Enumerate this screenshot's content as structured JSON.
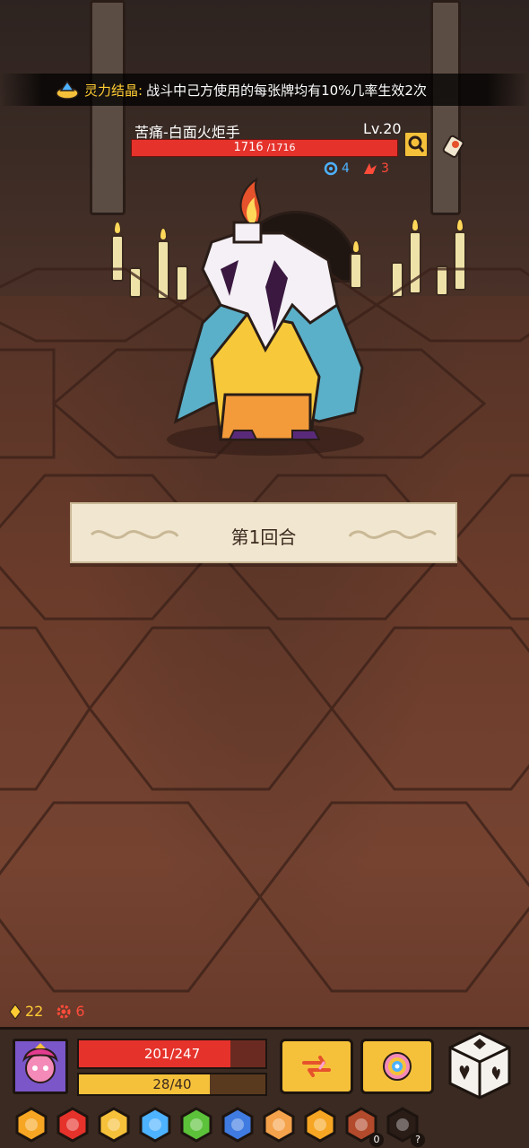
{
  "banner": {
    "tag": "灵力结晶:",
    "text": "战斗中己方使用的每张牌均有10%几率生效2次"
  },
  "enemy": {
    "name": "苦痛-白面火炬手",
    "level": "Lv.20",
    "hp_text": "1716",
    "hp_max_text": "/1716",
    "hp_fraction": 1.0,
    "shield": "4",
    "attack": "3"
  },
  "round": {
    "label": "第1回合"
  },
  "player": {
    "energy": "22",
    "gear": "6",
    "hp_text": "201/247",
    "hp_fraction": 0.8138,
    "mp_text": "28/40",
    "mp_fraction": 0.7
  },
  "tray": {
    "items": [
      {
        "icon": "claw-gauntlet-icon",
        "color": "#f6a623"
      },
      {
        "icon": "red-horn-icon",
        "color": "#e5322b"
      },
      {
        "icon": "gold-armor-icon",
        "color": "#f6c13a"
      },
      {
        "icon": "diamond-badge-icon",
        "color": "#4db2ff"
      },
      {
        "icon": "green-potion-icon",
        "color": "#5bc23a"
      },
      {
        "icon": "blue-sickle-icon",
        "color": "#3f7be0"
      },
      {
        "icon": "target-disc-icon",
        "color": "#f4a24b"
      },
      {
        "icon": "fire-crown-icon",
        "color": "#f6a623"
      },
      {
        "icon": "bowl-icon",
        "color": "#b24a2b",
        "badge": "0"
      },
      {
        "icon": "magic-hat-dice-icon",
        "color": "#2a1d18",
        "badge": "?"
      }
    ]
  },
  "colors": {
    "hp": "#e5322b",
    "mp": "#f6c13a",
    "accent": "#ffcc33"
  }
}
